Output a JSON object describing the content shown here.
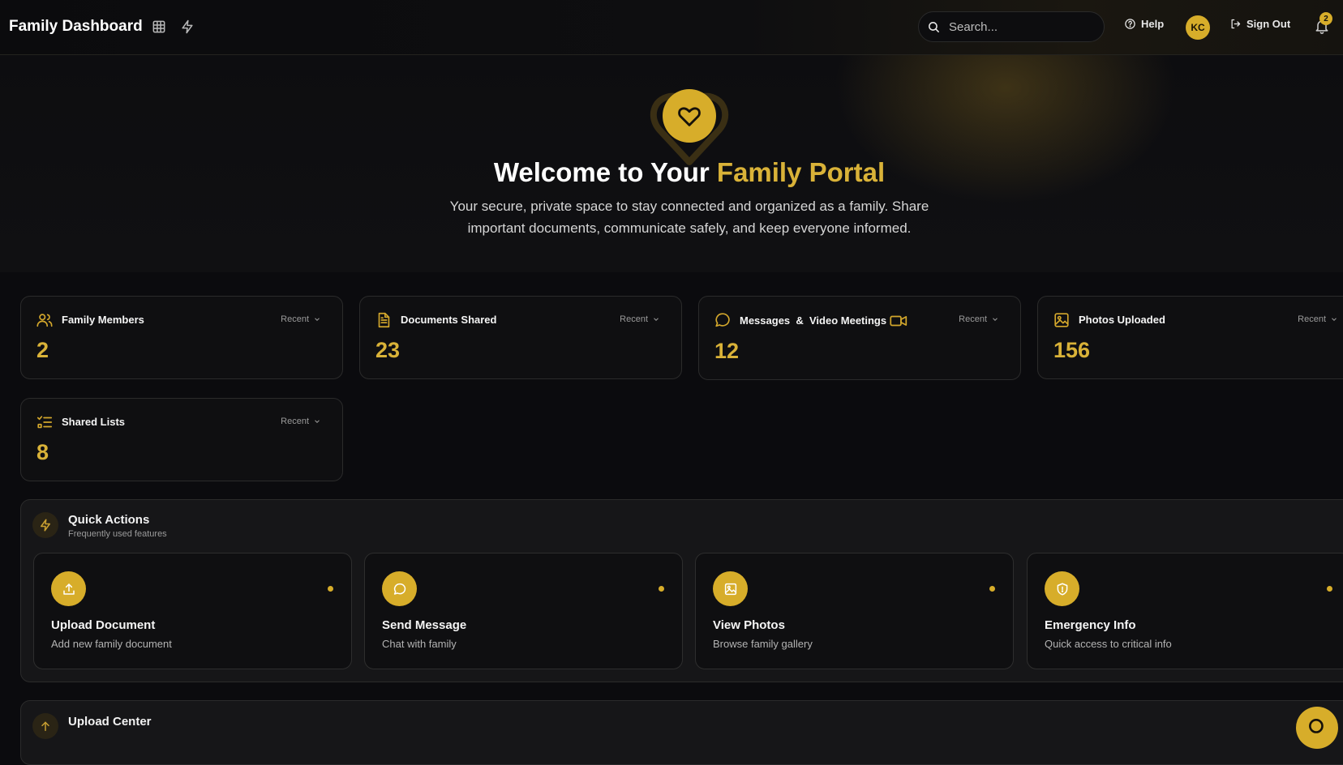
{
  "header": {
    "title": "Family Dashboard",
    "search_placeholder": "Search...",
    "help_label": "Help",
    "avatar_initials": "KC",
    "signout_label": "Sign Out",
    "notification_count": "2"
  },
  "hero": {
    "title_main": "Welcome to Your ",
    "title_accent": "Family Portal",
    "subtitle": "Your secure, private space to stay connected and organized as a family. Share important documents, communicate safely, and keep everyone informed."
  },
  "stats": [
    {
      "title": "Family Members",
      "value": "2",
      "filter": "Recent",
      "icon": "users-icon"
    },
    {
      "title": "Documents Shared",
      "value": "23",
      "filter": "Recent",
      "icon": "document-icon"
    },
    {
      "title": "Messages  &  Video Meetings",
      "value": "12",
      "filter": "Recent",
      "icon": "message-icon"
    },
    {
      "title": "Photos Uploaded",
      "value": "156",
      "filter": "Recent",
      "icon": "image-icon"
    },
    {
      "title": "Shared Lists",
      "value": "8",
      "filter": "Recent",
      "icon": "list-icon"
    }
  ],
  "quick_actions": {
    "title": "Quick Actions",
    "subtitle": "Frequently used features",
    "items": [
      {
        "label": "Upload Document",
        "desc": "Add new family document",
        "icon": "upload-icon"
      },
      {
        "label": "Send Message",
        "desc": "Chat with family",
        "icon": "chat-icon"
      },
      {
        "label": "View Photos",
        "desc": "Browse family gallery",
        "icon": "photo-icon"
      },
      {
        "label": "Emergency Info",
        "desc": "Quick access to critical info",
        "icon": "shield-icon"
      }
    ]
  },
  "upload_center": {
    "title": "Upload Center"
  },
  "colors": {
    "accent": "#d7ad2a",
    "background": "#0b0b0e",
    "card": "#0f0f11",
    "panel": "#161618"
  }
}
